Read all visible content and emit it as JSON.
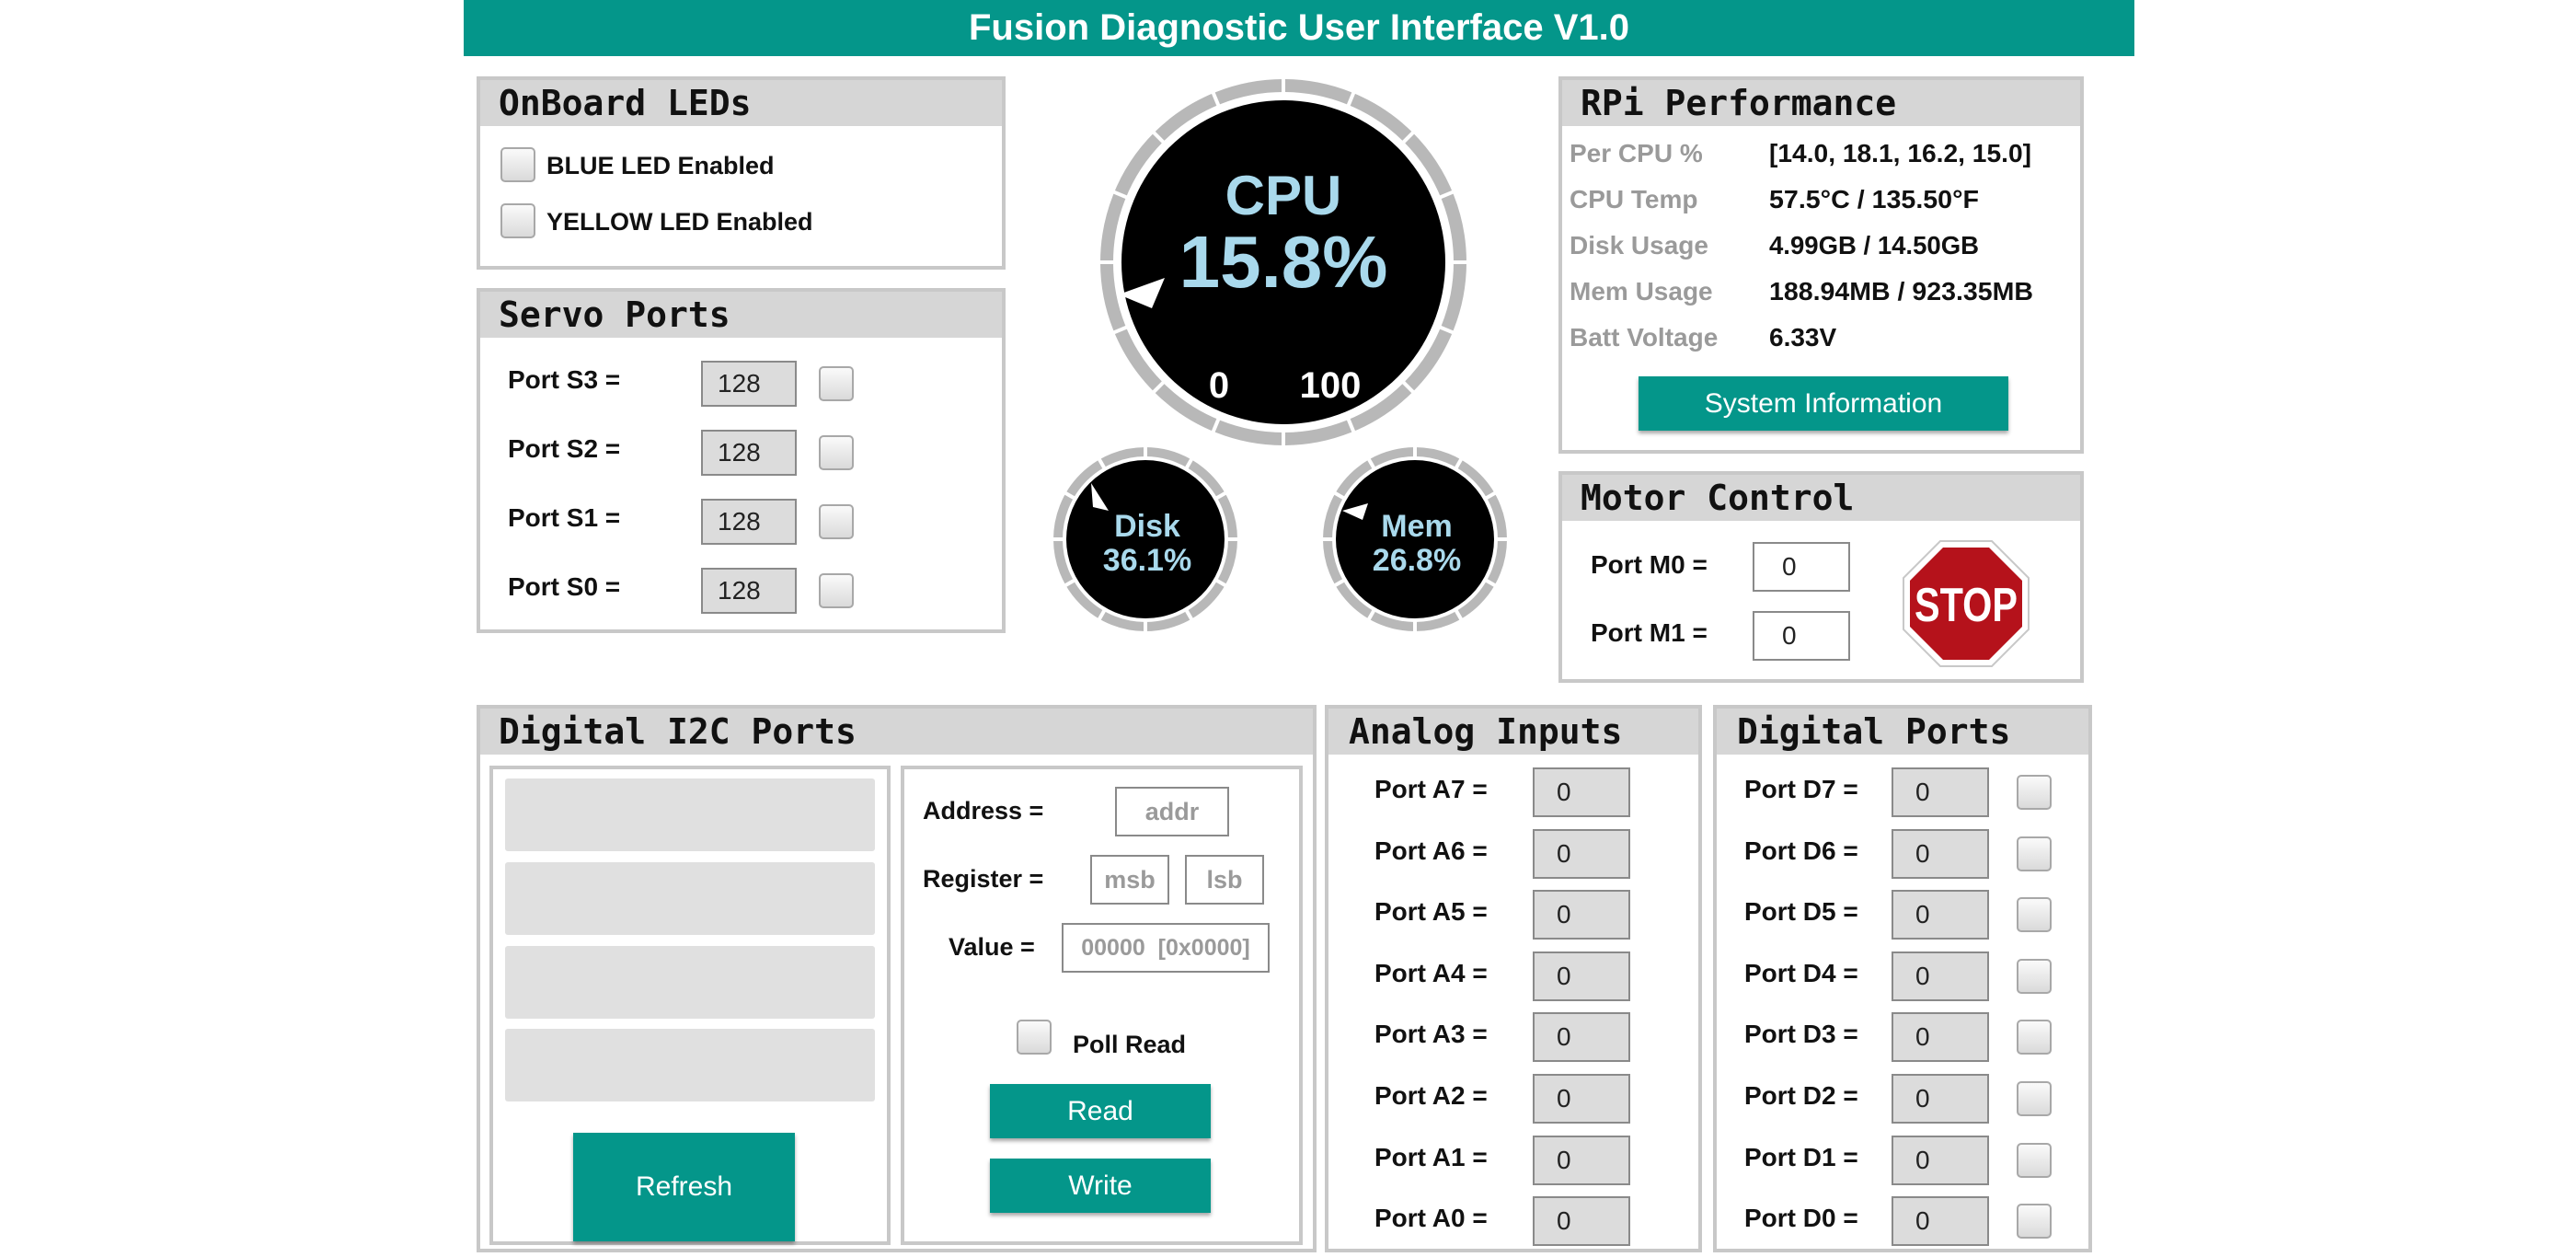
{
  "header": {
    "title": "Fusion Diagnostic User Interface V1.0"
  },
  "onboard_leds": {
    "title": "OnBoard LEDs",
    "items": [
      {
        "label": "BLUE LED Enabled",
        "checked": false
      },
      {
        "label": "YELLOW LED Enabled",
        "checked": false
      }
    ]
  },
  "servo_ports": {
    "title": "Servo Ports",
    "rows": [
      {
        "label": "Port S3 =",
        "value": "128"
      },
      {
        "label": "Port S2 =",
        "value": "128"
      },
      {
        "label": "Port S1 =",
        "value": "128"
      },
      {
        "label": "Port S0 =",
        "value": "128"
      }
    ]
  },
  "gauges": {
    "cpu": {
      "title": "CPU",
      "value_text": "15.8%",
      "value": 15.8,
      "min_label": "0",
      "max_label": "100"
    },
    "disk": {
      "title": "Disk",
      "value_text": "36.1%",
      "value": 36.1
    },
    "mem": {
      "title": "Mem",
      "value_text": "26.8%",
      "value": 26.8
    }
  },
  "rpi_performance": {
    "title": "RPi Performance",
    "rows": [
      {
        "key": "Per CPU %",
        "value": "[14.0, 18.1, 16.2, 15.0]"
      },
      {
        "key": "CPU Temp",
        "value": "57.5°C / 135.50°F"
      },
      {
        "key": "Disk Usage",
        "value": "4.99GB / 14.50GB"
      },
      {
        "key": "Mem Usage",
        "value": "188.94MB / 923.35MB"
      },
      {
        "key": "Batt Voltage",
        "value": "6.33V"
      }
    ],
    "button": "System Information"
  },
  "motor_control": {
    "title": "Motor Control",
    "rows": [
      {
        "label": "Port M0 =",
        "value": "0"
      },
      {
        "label": "Port M1 =",
        "value": "0"
      }
    ],
    "stop_label": "STOP"
  },
  "i2c": {
    "title": "Digital I2C Ports",
    "refresh_label": "Refresh",
    "address_label": "Address =",
    "address_placeholder": "addr",
    "register_label": "Register =",
    "msb_placeholder": "msb",
    "lsb_placeholder": "lsb",
    "value_label": "Value =",
    "value_placeholder": "00000  [0x0000]",
    "poll_read_label": "Poll Read",
    "read_label": "Read",
    "write_label": "Write"
  },
  "analog_inputs": {
    "title": "Analog Inputs",
    "rows": [
      {
        "label": "Port A7 =",
        "value": "0"
      },
      {
        "label": "Port A6 =",
        "value": "0"
      },
      {
        "label": "Port A5 =",
        "value": "0"
      },
      {
        "label": "Port A4 =",
        "value": "0"
      },
      {
        "label": "Port A3 =",
        "value": "0"
      },
      {
        "label": "Port A2 =",
        "value": "0"
      },
      {
        "label": "Port A1 =",
        "value": "0"
      },
      {
        "label": "Port A0 =",
        "value": "0"
      }
    ]
  },
  "digital_ports": {
    "title": "Digital Ports",
    "rows": [
      {
        "label": "Port D7 =",
        "value": "0"
      },
      {
        "label": "Port D6 =",
        "value": "0"
      },
      {
        "label": "Port D5 =",
        "value": "0"
      },
      {
        "label": "Port D4 =",
        "value": "0"
      },
      {
        "label": "Port D3 =",
        "value": "0"
      },
      {
        "label": "Port D2 =",
        "value": "0"
      },
      {
        "label": "Port D1 =",
        "value": "0"
      },
      {
        "label": "Port D0 =",
        "value": "0"
      }
    ]
  },
  "colors": {
    "accent": "#04968a",
    "gauge_text": "#a9d9ec",
    "stop_red": "#b5121b",
    "panel_border": "#c8c8c8",
    "panel_header": "#d6d6d6"
  }
}
